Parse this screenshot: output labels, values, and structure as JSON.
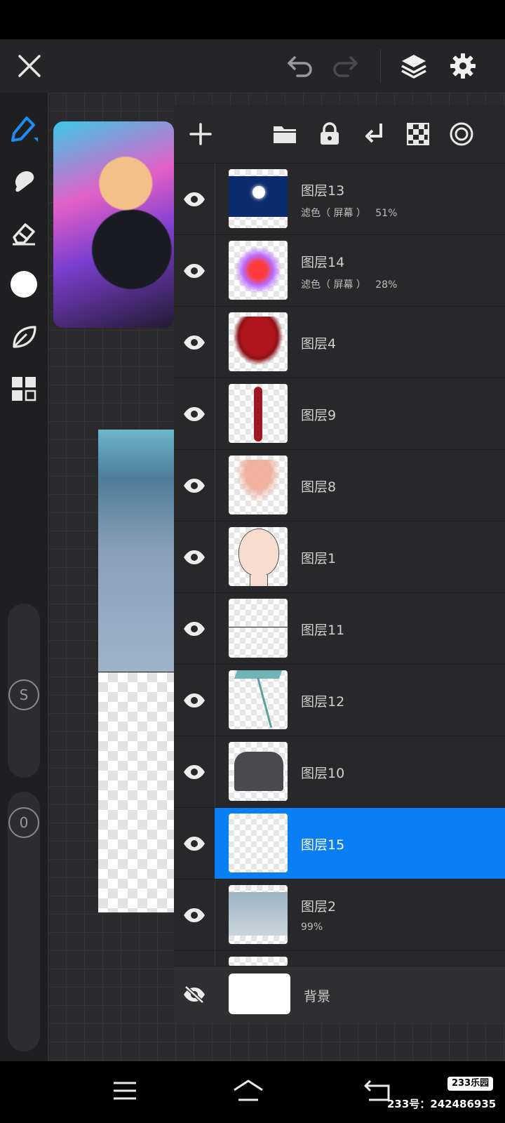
{
  "toolbar": {
    "close": "close-icon",
    "undo": "undo-icon",
    "redo": "redo-icon",
    "layers": "layers-icon",
    "settings": "gear-icon"
  },
  "left_tools": {
    "slider_size_label": "S",
    "slider_opacity_label": "0",
    "accent_color": "#1e8cf0",
    "current_color": "#ffffff"
  },
  "layer_panel_tools": [
    "add-layer-icon",
    "folder-icon",
    "lock-icon",
    "merge-down-icon",
    "transparency-icon",
    "target-icon"
  ],
  "layers": [
    {
      "name": "图层13",
      "sub": "滤色（ 屏幕 ）   51%",
      "visible": true,
      "selected": false
    },
    {
      "name": "图层14",
      "sub": "滤色（ 屏幕 ）   28%",
      "visible": true,
      "selected": false
    },
    {
      "name": "图层4",
      "sub": "",
      "visible": true,
      "selected": false
    },
    {
      "name": "图层9",
      "sub": "",
      "visible": true,
      "selected": false
    },
    {
      "name": "图层8",
      "sub": "",
      "visible": true,
      "selected": false
    },
    {
      "name": "图层1",
      "sub": "",
      "visible": true,
      "selected": false
    },
    {
      "name": "图层11",
      "sub": "",
      "visible": true,
      "selected": false
    },
    {
      "name": "图层12",
      "sub": "",
      "visible": true,
      "selected": false
    },
    {
      "name": "图层10",
      "sub": "",
      "visible": true,
      "selected": false
    },
    {
      "name": "图层15",
      "sub": "",
      "visible": true,
      "selected": true
    },
    {
      "name": "图层2",
      "sub": "99%",
      "visible": true,
      "selected": false
    }
  ],
  "background_layer": {
    "name": "背景",
    "visible": false
  },
  "selected_color": "#0a7ef5",
  "watermark": {
    "brand": "233乐园",
    "id_label": "233号：",
    "id_value": "242486935"
  }
}
